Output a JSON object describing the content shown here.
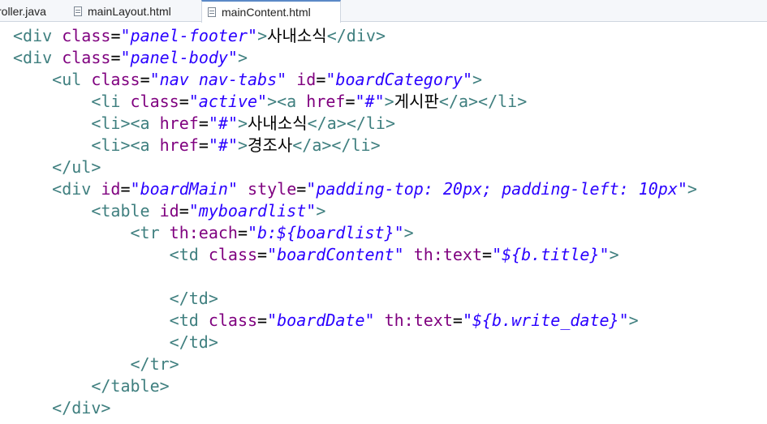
{
  "tabs": [
    {
      "label": "roller.java",
      "active": false
    },
    {
      "label": "mainLayout.html",
      "active": false
    },
    {
      "label": "mainContent.html",
      "active": true
    }
  ],
  "code_lines": [
    "<div class=\"panel-footer\">사내소식</div>",
    "<div class=\"panel-body\">",
    "    <ul class=\"nav nav-tabs\" id=\"boardCategory\">",
    "        <li class=\"active\"><a href=\"#\">게시판</a></li>",
    "        <li><a href=\"#\">사내소식</a></li>",
    "        <li><a href=\"#\">경조사</a></li>",
    "    </ul>",
    "    <div id=\"boardMain\" style=\"padding-top: 20px; padding-left: 10px\">",
    "        <table id=\"myboardlist\">",
    "            <tr th:each=\"b:${boardlist}\">",
    "                <td class=\"boardContent\" th:text=\"${b.title}\">",
    "",
    "                </td>",
    "                <td class=\"boardDate\" th:text=\"${b.write_date}\">",
    "                </td>",
    "            </tr>",
    "        </table>",
    "    </div>"
  ],
  "colors": {
    "tag": "#3f7f7f",
    "attribute": "#7f007f",
    "value": "#2a00ff",
    "text": "#000000",
    "active_tab_accent": "#5b89c7"
  }
}
